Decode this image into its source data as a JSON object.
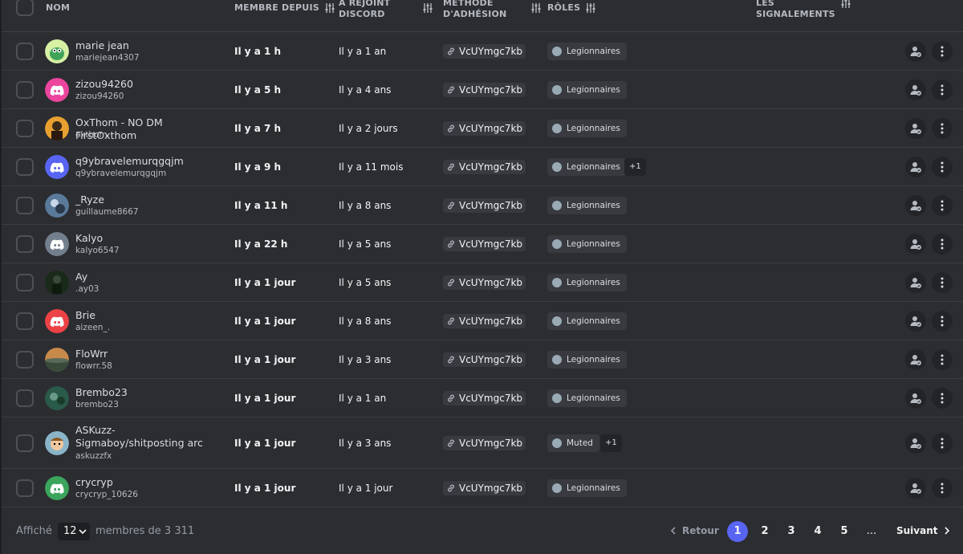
{
  "header": {
    "name": "NOM",
    "member_since": "MEMBRE DEPUIS",
    "joined_discord_1": "A REJOINT",
    "joined_discord_2": "DISCORD",
    "join_method_1": "MÉTHODE",
    "join_method_2": "D'ADHÉSION",
    "roles": "RÔLES",
    "reports_1": "LES",
    "reports_2": "SIGNALEMENTS"
  },
  "rows": [
    {
      "name": "marie jean",
      "handle": "mariejean4307",
      "member_since": "Il y a 1 h",
      "joined": "Il y a 1 an",
      "invite": "VcUYmgc7kb",
      "role": "Legionnaires",
      "extra": "",
      "avatar": "green-creature"
    },
    {
      "name": "zizou94260",
      "handle": "zizou94260",
      "member_since": "Il y a 5 h",
      "joined": "Il y a 4 ans",
      "invite": "VcUYmgc7kb",
      "role": "Legionnaires",
      "extra": "",
      "avatar": "discord-pink"
    },
    {
      "name": "OxThom - NO DM FirstOxthom",
      "handle": "oxthom",
      "member_since": "Il y a 7 h",
      "joined": "Il y a 2 jours",
      "invite": "VcUYmgc7kb",
      "role": "Legionnaires",
      "extra": "",
      "avatar": "orange-photo"
    },
    {
      "name": "q9ybravelemurqgqjm",
      "handle": "q9ybravelemurqgqjm",
      "member_since": "Il y a 9 h",
      "joined": "Il y a 11 mois",
      "invite": "VcUYmgc7kb",
      "role": "Legionnaires",
      "extra": "+1",
      "avatar": "discord-blurple"
    },
    {
      "name": "_Ryze",
      "handle": "guillaume8667",
      "member_since": "Il y a 11 h",
      "joined": "Il y a 8 ans",
      "invite": "VcUYmgc7kb",
      "role": "Legionnaires",
      "extra": "",
      "avatar": "blue-photo"
    },
    {
      "name": "Kalyo",
      "handle": "kalyo6547",
      "member_since": "Il y a 22 h",
      "joined": "Il y a 5 ans",
      "invite": "VcUYmgc7kb",
      "role": "Legionnaires",
      "extra": "",
      "avatar": "discord-grey"
    },
    {
      "name": "Ay",
      "handle": ".ay03",
      "member_since": "Il y a 1 jour",
      "joined": "Il y a 5 ans",
      "invite": "VcUYmgc7kb",
      "role": "Legionnaires",
      "extra": "",
      "avatar": "dark-photo"
    },
    {
      "name": "Brie",
      "handle": "aizeen_.",
      "member_since": "Il y a 1 jour",
      "joined": "Il y a 8 ans",
      "invite": "VcUYmgc7kb",
      "role": "Legionnaires",
      "extra": "",
      "avatar": "discord-red"
    },
    {
      "name": "FloWrr",
      "handle": "flowrr.58",
      "member_since": "Il y a 1 jour",
      "joined": "Il y a 3 ans",
      "invite": "VcUYmgc7kb",
      "role": "Legionnaires",
      "extra": "",
      "avatar": "landscape-photo"
    },
    {
      "name": "Brembo23",
      "handle": "brembo23",
      "member_since": "Il y a 1 jour",
      "joined": "Il y a 1 an",
      "invite": "VcUYmgc7kb",
      "role": "Legionnaires",
      "extra": "",
      "avatar": "teal-photo"
    },
    {
      "name": "ASKuzz-Sigmaboy/shitposting arc",
      "handle": "askuzzfx",
      "member_since": "Il y a 1 jour",
      "joined": "Il y a 3 ans",
      "invite": "VcUYmgc7kb",
      "role": "Muted",
      "extra": "+1",
      "avatar": "cartoon-face"
    },
    {
      "name": "crycryp",
      "handle": "crycryp_10626",
      "member_since": "Il y a 1 jour",
      "joined": "Il y a 1 jour",
      "invite": "VcUYmgc7kb",
      "role": "Legionnaires",
      "extra": "",
      "avatar": "discord-green"
    }
  ],
  "footer": {
    "shown_label": "Affiché",
    "page_size": "12",
    "members_label": "membres de 3 311",
    "prev_label": "Retour",
    "next_label": "Suivant",
    "pages": [
      "1",
      "2",
      "3",
      "4",
      "5"
    ],
    "ellipsis": "...",
    "active_page": "1"
  },
  "colors": {
    "accent": "#5865f2",
    "discord-pink": "#eb459e",
    "discord-blurple": "#5865f2",
    "discord-grey": "#747f8d",
    "discord-red": "#ed4245",
    "discord-green": "#3ba55c",
    "role-dot": "#99aab5"
  }
}
